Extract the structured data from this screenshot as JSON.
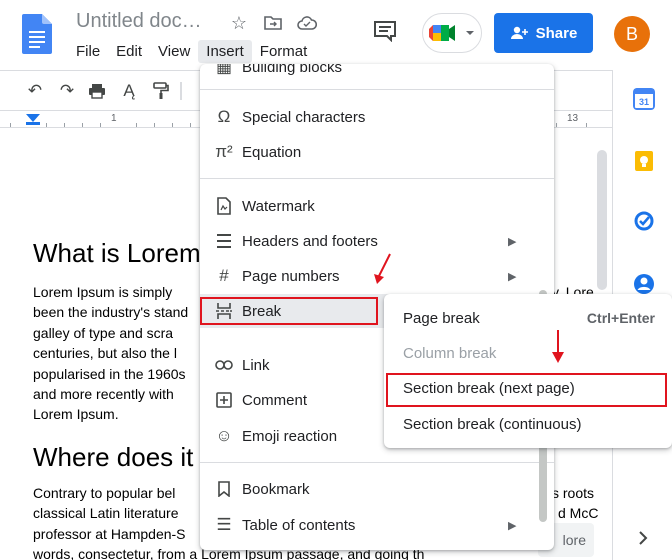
{
  "header": {
    "doc_title": "Untitled doc…",
    "menus": [
      "File",
      "Edit",
      "View",
      "Insert",
      "Format"
    ],
    "active_menu": "Insert",
    "share_label": "Share",
    "avatar_initial": "B"
  },
  "ruler": {
    "mark_left": "1",
    "mark_right": "13"
  },
  "document": {
    "heading1": "What is Lorem",
    "para1_lines": [
      "Lorem Ipsum is simply",
      "been the industry's stand",
      "galley of type and scra",
      "centuries, but also the l",
      "popularised in the 1960s",
      "and more recently with",
      "Lorem Ipsum."
    ],
    "para1_right": [
      "y. Lore",
      "",
      "",
      "",
      "",
      "",
      ""
    ],
    "heading2": "Where does it",
    "para2_lines": [
      "Contrary to popular bel",
      "classical Latin literature",
      "professor at Hampden-S",
      "words, consectetur, from a Lorem Ipsum passage, and going th"
    ],
    "para2_right": [
      "s roots",
      "d McC",
      "",
      ""
    ],
    "more_label": "lore"
  },
  "insert_menu": {
    "partial_item": "Building blocks",
    "items": [
      {
        "label": "Special characters",
        "icon": "omega-icon"
      },
      {
        "label": "Equation",
        "icon": "pi-icon"
      },
      {
        "label": "Watermark",
        "icon": "watermark-icon"
      },
      {
        "label": "Headers and footers",
        "icon": "header-footer-icon",
        "submenu": true
      },
      {
        "label": "Page numbers",
        "icon": "hash-icon",
        "submenu": true
      },
      {
        "label": "Break",
        "icon": "break-icon",
        "submenu": true
      },
      {
        "label": "Link",
        "icon": "link-icon"
      },
      {
        "label": "Comment",
        "icon": "comment-add-icon"
      },
      {
        "label": "Emoji reaction",
        "icon": "emoji-icon"
      },
      {
        "label": "Bookmark",
        "icon": "bookmark-icon"
      },
      {
        "label": "Table of contents",
        "icon": "toc-icon",
        "submenu": true
      }
    ]
  },
  "break_submenu": {
    "items": [
      {
        "label": "Page break",
        "shortcut": "Ctrl+Enter",
        "disabled": false
      },
      {
        "label": "Column break",
        "shortcut": "",
        "disabled": true
      },
      {
        "label": "Section break (next page)",
        "shortcut": "",
        "disabled": false
      },
      {
        "label": "Section break (continuous)",
        "shortcut": "",
        "disabled": false
      }
    ]
  },
  "colors": {
    "share_blue": "#1a73e8",
    "avatar_orange": "#e8710a",
    "annotation_red": "#e0141e"
  }
}
